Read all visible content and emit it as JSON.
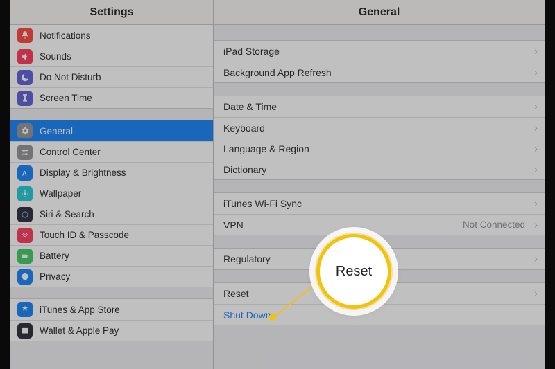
{
  "sidebar": {
    "title": "Settings",
    "groups": [
      {
        "items": [
          {
            "icon": "notifications-icon",
            "color": "#ff3b30",
            "label": "Notifications"
          },
          {
            "icon": "sounds-icon",
            "color": "#ff2d55",
            "label": "Sounds"
          },
          {
            "icon": "dnd-icon",
            "color": "#5856d6",
            "label": "Do Not Disturb"
          },
          {
            "icon": "screentime-icon",
            "color": "#5856d6",
            "label": "Screen Time"
          }
        ]
      },
      {
        "items": [
          {
            "icon": "general-icon",
            "color": "#8e8e93",
            "label": "General",
            "selected": true
          },
          {
            "icon": "control-center-icon",
            "color": "#8e8e93",
            "label": "Control Center"
          },
          {
            "icon": "display-icon",
            "color": "#0a7cf7",
            "label": "Display & Brightness"
          },
          {
            "icon": "wallpaper-icon",
            "color": "#17c7d1",
            "label": "Wallpaper"
          },
          {
            "icon": "siri-icon",
            "color": "#1f1f2e",
            "label": "Siri & Search"
          },
          {
            "icon": "touchid-icon",
            "color": "#ff2d55",
            "label": "Touch ID & Passcode"
          },
          {
            "icon": "battery-icon",
            "color": "#34c759",
            "label": "Battery"
          },
          {
            "icon": "privacy-icon",
            "color": "#0a7cf7",
            "label": "Privacy"
          }
        ]
      },
      {
        "items": [
          {
            "icon": "appstore-icon",
            "color": "#0a7cf7",
            "label": "iTunes & App Store"
          },
          {
            "icon": "wallet-icon",
            "color": "#1f1f2e",
            "label": "Wallet & Apple Pay"
          }
        ]
      }
    ]
  },
  "detail": {
    "title": "General",
    "groups": [
      [
        {
          "label": "iPad Storage"
        },
        {
          "label": "Background App Refresh"
        }
      ],
      [
        {
          "label": "Date & Time"
        },
        {
          "label": "Keyboard"
        },
        {
          "label": "Language & Region"
        },
        {
          "label": "Dictionary"
        }
      ],
      [
        {
          "label": "iTunes Wi-Fi Sync"
        },
        {
          "label": "VPN",
          "value": "Not Connected"
        }
      ],
      [
        {
          "label": "Regulatory"
        }
      ],
      [
        {
          "label": "Reset"
        },
        {
          "label": "Shut Down",
          "link": true,
          "no_chevron": true
        }
      ]
    ]
  },
  "callout": {
    "text": "Reset"
  },
  "colors": {
    "accent_blue": "#0a7cf7",
    "highlight_yellow": "#f2c20c"
  }
}
